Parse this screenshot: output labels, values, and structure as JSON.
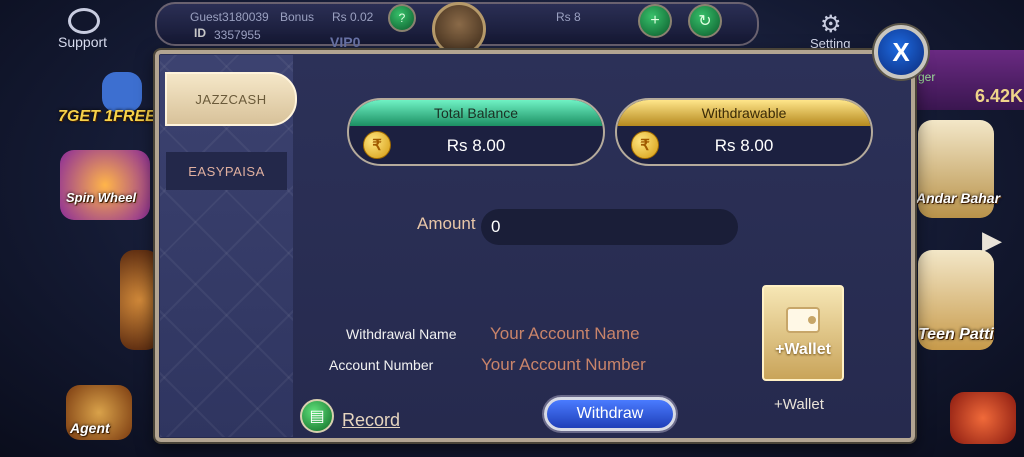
{
  "background": {
    "support_label": "Support",
    "setting_label": "Setting",
    "guest_name": "Guest3180039",
    "id_label": "ID",
    "id_value": "3357955",
    "bonus_label": "Bonus",
    "bonus_value": "Rs 0.02",
    "balance_value": "Rs 8",
    "vip_label": "VIP0",
    "right_value": "6.42K",
    "right_label": "ger",
    "promo_text": "7GET 1FREE",
    "spin_wheel": "Spin Wheel",
    "agent_label": "Agent",
    "andar_bahar": "Andar Bahar",
    "teen_patti": "Teen Patti"
  },
  "dialog": {
    "tabs": [
      {
        "label": "JAZZCASH",
        "active": true
      },
      {
        "label": "EASYPAISA",
        "active": false
      }
    ],
    "total_balance": {
      "title": "Total Balance",
      "value": "Rs 8.00"
    },
    "withdrawable": {
      "title": "Withdrawable",
      "value": "Rs 8.00"
    },
    "amount": {
      "label": "Amount",
      "value": "0"
    },
    "withdrawal_name": {
      "label": "Withdrawal Name",
      "value": "Your Account Name"
    },
    "account_number": {
      "label": "Account Number",
      "value": "Your Account Number"
    },
    "record_label": "Record",
    "withdraw_label": "Withdraw",
    "wallet_button_label": "+Wallet",
    "wallet_caption": "+Wallet",
    "close_label": "X",
    "coin_glyph": "₹"
  },
  "colors": {
    "accent_green": "#1c8f63",
    "accent_gold": "#b5891f",
    "withdraw_blue": "#1f3fb8",
    "close_blue": "#1d6ae0"
  }
}
